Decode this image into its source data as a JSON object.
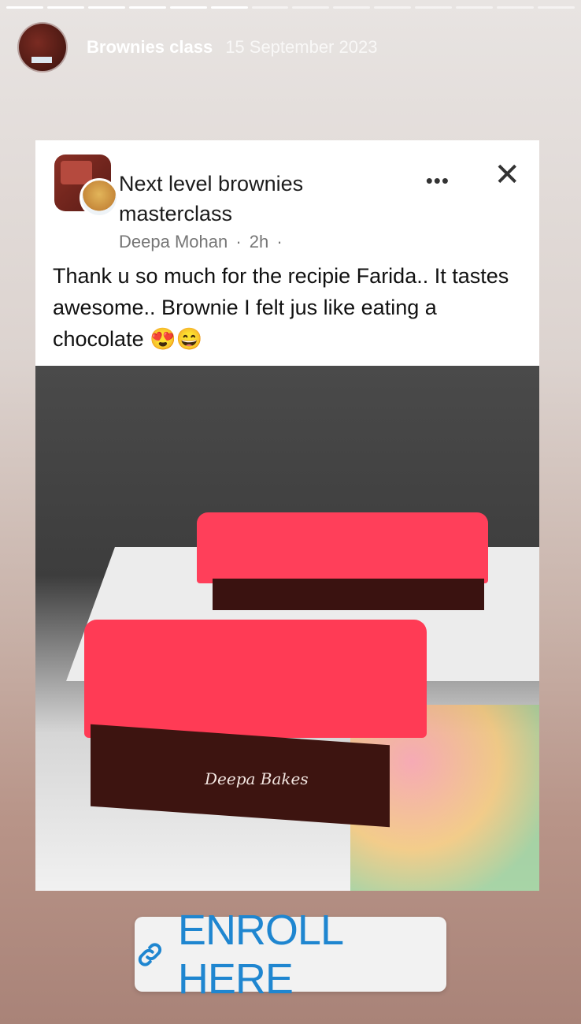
{
  "story": {
    "title": "Brownies class",
    "date": "15 September 2023",
    "progress_segments": 14,
    "progress_done": 6
  },
  "post": {
    "group_name": "Next level brownies masterclass",
    "author": "Deepa Mohan",
    "time": "2h",
    "more_label": "•••",
    "close_label": "✕",
    "text": "Thank u so much for the recipie Farida.. It tastes awesome.. Brownie I felt jus like eating a chocolate 😍😄",
    "photo_watermark": "Deepa Bakes"
  },
  "cta": {
    "label": "ENROLL HERE",
    "icon": "link-icon",
    "color": "#1f86d0"
  }
}
